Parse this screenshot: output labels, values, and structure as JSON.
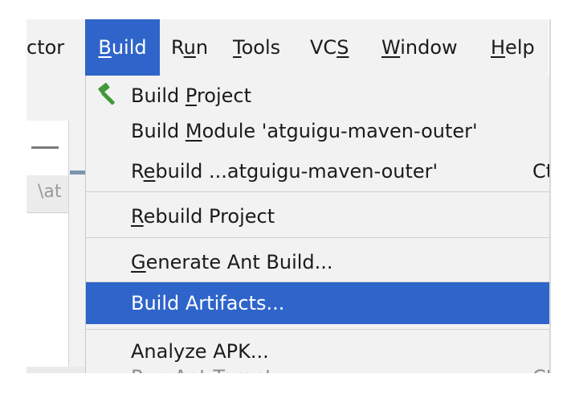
{
  "menubar": {
    "items": [
      {
        "label_pre": "",
        "mnemonic": "",
        "label_post": "ctor"
      },
      {
        "label_pre": "",
        "mnemonic": "B",
        "label_post": "uild"
      },
      {
        "label_pre": "R",
        "mnemonic": "u",
        "label_post": "n"
      },
      {
        "label_pre": "",
        "mnemonic": "T",
        "label_post": "ools"
      },
      {
        "label_pre": "VC",
        "mnemonic": "S",
        "label_post": ""
      },
      {
        "label_pre": "",
        "mnemonic": "W",
        "label_post": "indow"
      },
      {
        "label_pre": "",
        "mnemonic": "H",
        "label_post": "elp"
      }
    ],
    "active_index": 1
  },
  "background": {
    "path_fragment": "\\at"
  },
  "build_menu": {
    "items": [
      {
        "pre": "Build ",
        "mnemonic": "P",
        "post": "roject",
        "shortcut": "",
        "icon": "hammer-icon",
        "state": "normal"
      },
      {
        "pre": "Build ",
        "mnemonic": "M",
        "post": "odule 'atguigu-maven-outer'",
        "shortcut": "",
        "icon": "",
        "state": "normal"
      },
      {
        "pre": "R",
        "mnemonic": "e",
        "post": "build ...atguigu-maven-outer'",
        "shortcut": "Ct",
        "icon": "",
        "state": "normal"
      },
      {
        "pre": "",
        "mnemonic": "R",
        "post": "ebuild Project",
        "shortcut": "",
        "icon": "",
        "state": "normal"
      },
      {
        "pre": "",
        "mnemonic": "G",
        "post": "enerate Ant Build...",
        "shortcut": "",
        "icon": "",
        "state": "normal"
      },
      {
        "pre": "Build Artifacts...",
        "mnemonic": "",
        "post": "",
        "shortcut": "",
        "icon": "",
        "state": "selected"
      },
      {
        "pre": "Analyze APK...",
        "mnemonic": "",
        "post": "",
        "shortcut": "",
        "icon": "",
        "state": "normal"
      },
      {
        "pre": "Run Ant Target",
        "mnemonic": "",
        "post": "",
        "shortcut": "Ctr",
        "icon": "",
        "state": "disabled"
      }
    ]
  },
  "colors": {
    "selection": "#2f65ca",
    "menu_background": "#f2f2f2",
    "hammer": "#3f9a3a",
    "disabled_text": "#8c8c8c"
  }
}
